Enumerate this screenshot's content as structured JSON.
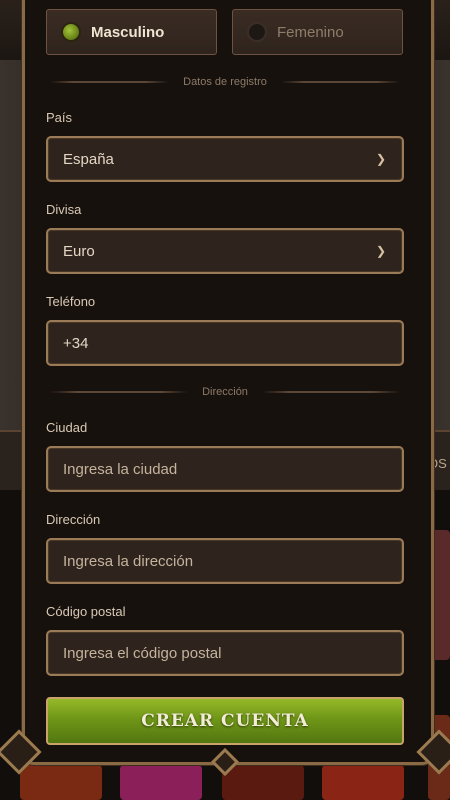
{
  "gender": {
    "options": [
      {
        "label": "Masculino",
        "selected": true
      },
      {
        "label": "Femenino",
        "selected": false
      }
    ]
  },
  "sections": {
    "registration": "Datos de registro",
    "address": "Dirección"
  },
  "fields": {
    "country": {
      "label": "País",
      "value": "España"
    },
    "currency": {
      "label": "Divisa",
      "value": "Euro"
    },
    "phone": {
      "label": "Teléfono",
      "value": "+34"
    },
    "city": {
      "label": "Ciudad",
      "placeholder": "Ingresa la ciudad"
    },
    "address": {
      "label": "Dirección",
      "placeholder": "Ingresa la dirección"
    },
    "postal": {
      "label": "Código postal",
      "placeholder": "Ingresa el código postal"
    }
  },
  "submit_label": "CREAR CUENTA",
  "background": {
    "side_text": "OS"
  },
  "colors": {
    "accent_green": "#7fa41f",
    "gold_border": "#9a7a57",
    "panel": "#17110e"
  }
}
